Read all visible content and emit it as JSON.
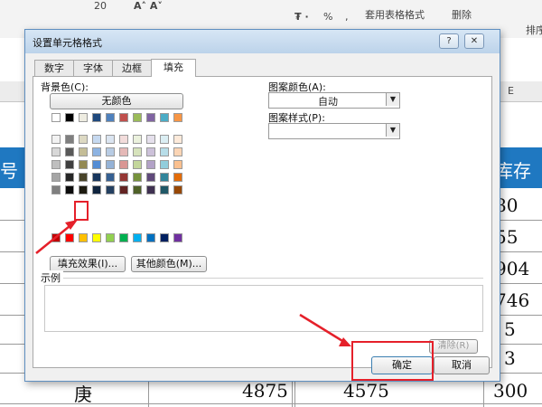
{
  "ribbon": {
    "font_size": "20",
    "percent": "%",
    "comma": ",",
    "table_format": "套用表格格式",
    "delete": "删除",
    "sort": "排序"
  },
  "sheet": {
    "col_e": "E",
    "header_left": "号",
    "header_right": "库存",
    "right_values": [
      "80",
      "55",
      "904",
      "746",
      "5",
      "3",
      "300"
    ],
    "last_row": {
      "name": "庚",
      "a": "4875",
      "b": "4575"
    }
  },
  "dialog": {
    "title": "设置单元格格式",
    "help": "?",
    "close": "✕",
    "tabs": [
      "数字",
      "字体",
      "边框",
      "填充"
    ],
    "active_tab": "填充",
    "bg_color_label": "背景色(C):",
    "no_color_button": "无颜色",
    "fill_effects_button": "填充效果(I)...",
    "more_colors_button": "其他颜色(M)...",
    "pattern_color_label": "图案颜色(A):",
    "pattern_color_value": "自动",
    "pattern_style_label": "图案样式(P):",
    "pattern_style_value": "",
    "sample_label": "示例",
    "clear_button": "清除(R)",
    "ok_button": "确定",
    "cancel_button": "取消"
  },
  "palette": {
    "theme_rows": [
      [
        "#ffffff",
        "#000000",
        "#eeece1",
        "#1f497d",
        "#4f81bd",
        "#c0504d",
        "#9bbb59",
        "#8064a2",
        "#4bacc6",
        "#f79646"
      ],
      [
        "#f2f2f2",
        "#7f7f7f",
        "#ddd9c3",
        "#c6d9f0",
        "#dbe5f1",
        "#f2dcdb",
        "#ebf1dd",
        "#e5e0ec",
        "#dbeef3",
        "#fdeada"
      ],
      [
        "#d8d8d8",
        "#595959",
        "#c4bd97",
        "#8db3e2",
        "#b8cce4",
        "#e5b9b7",
        "#d7e3bc",
        "#ccc1d9",
        "#b7dde8",
        "#fbd5b5"
      ],
      [
        "#bfbfbf",
        "#3f3f3f",
        "#938953",
        "#548dd4",
        "#95b3d7",
        "#d99694",
        "#c3d69b",
        "#b2a2c7",
        "#92cddc",
        "#fac08f"
      ],
      [
        "#a5a5a5",
        "#262626",
        "#494429",
        "#17365d",
        "#366092",
        "#953734",
        "#76923c",
        "#5f497a",
        "#31859b",
        "#e36c09"
      ],
      [
        "#7f7f7f",
        "#0c0c0c",
        "#1d1b10",
        "#0f243e",
        "#244061",
        "#632423",
        "#4f6128",
        "#3f3151",
        "#205867",
        "#974806"
      ]
    ],
    "standard_row": [
      "#c00000",
      "#ff0000",
      "#ffc000",
      "#ffff00",
      "#92d050",
      "#00b050",
      "#00b0f0",
      "#0070c0",
      "#002060",
      "#7030a0"
    ],
    "highlight_color": "#e5202a"
  }
}
